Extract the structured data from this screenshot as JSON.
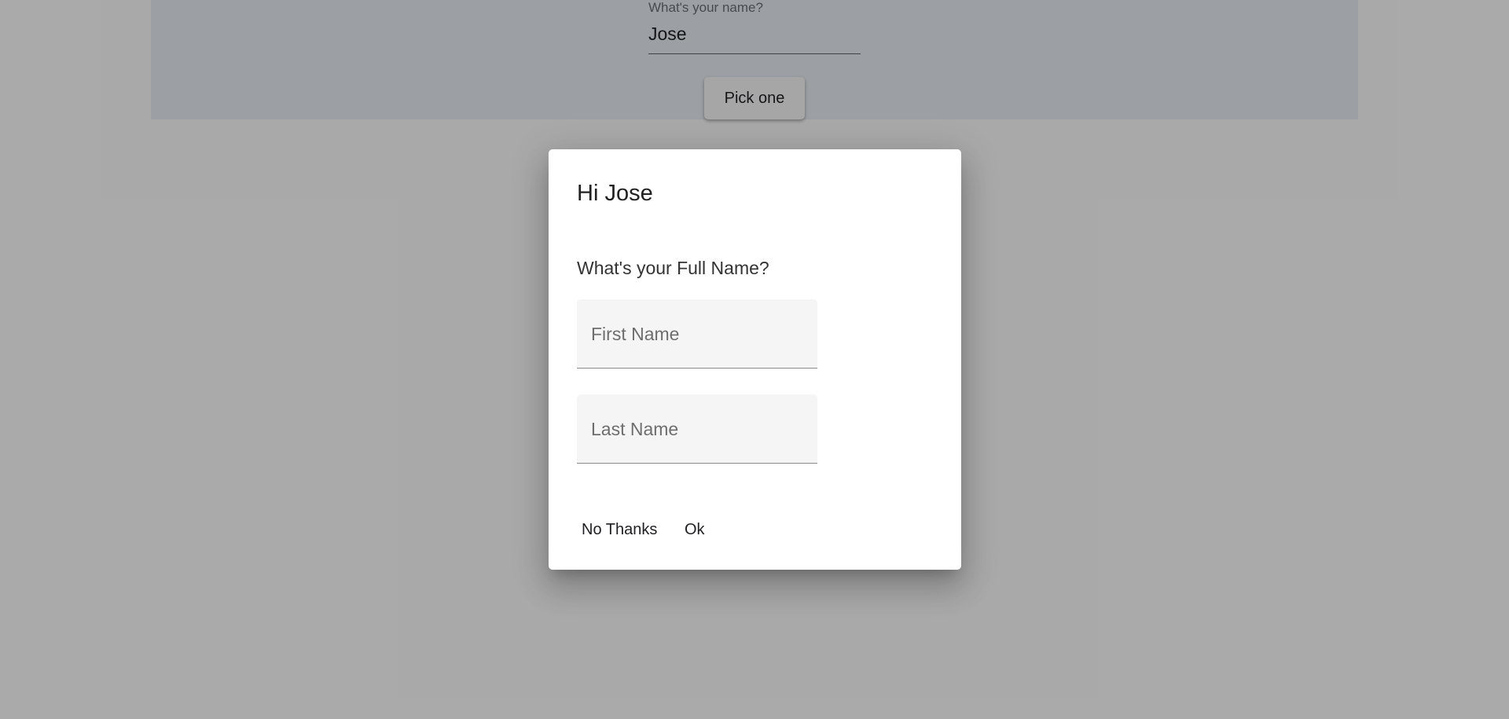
{
  "background_form": {
    "name_label": "What's your name?",
    "name_value": "Jose",
    "pick_button": "Pick one"
  },
  "dialog": {
    "title": "Hi Jose",
    "question": "What's your Full Name?",
    "first_name_placeholder": "First Name",
    "last_name_placeholder": "Last Name",
    "first_name_value": "",
    "last_name_value": "",
    "no_thanks_button": "No Thanks",
    "ok_button": "Ok"
  },
  "colors": {
    "page_background": "#fafafa",
    "panel_background": "#e6ebf0",
    "backdrop": "rgba(0,0,0,0.32)",
    "dialog_background": "#ffffff",
    "input_fill": "#f5f5f5"
  }
}
